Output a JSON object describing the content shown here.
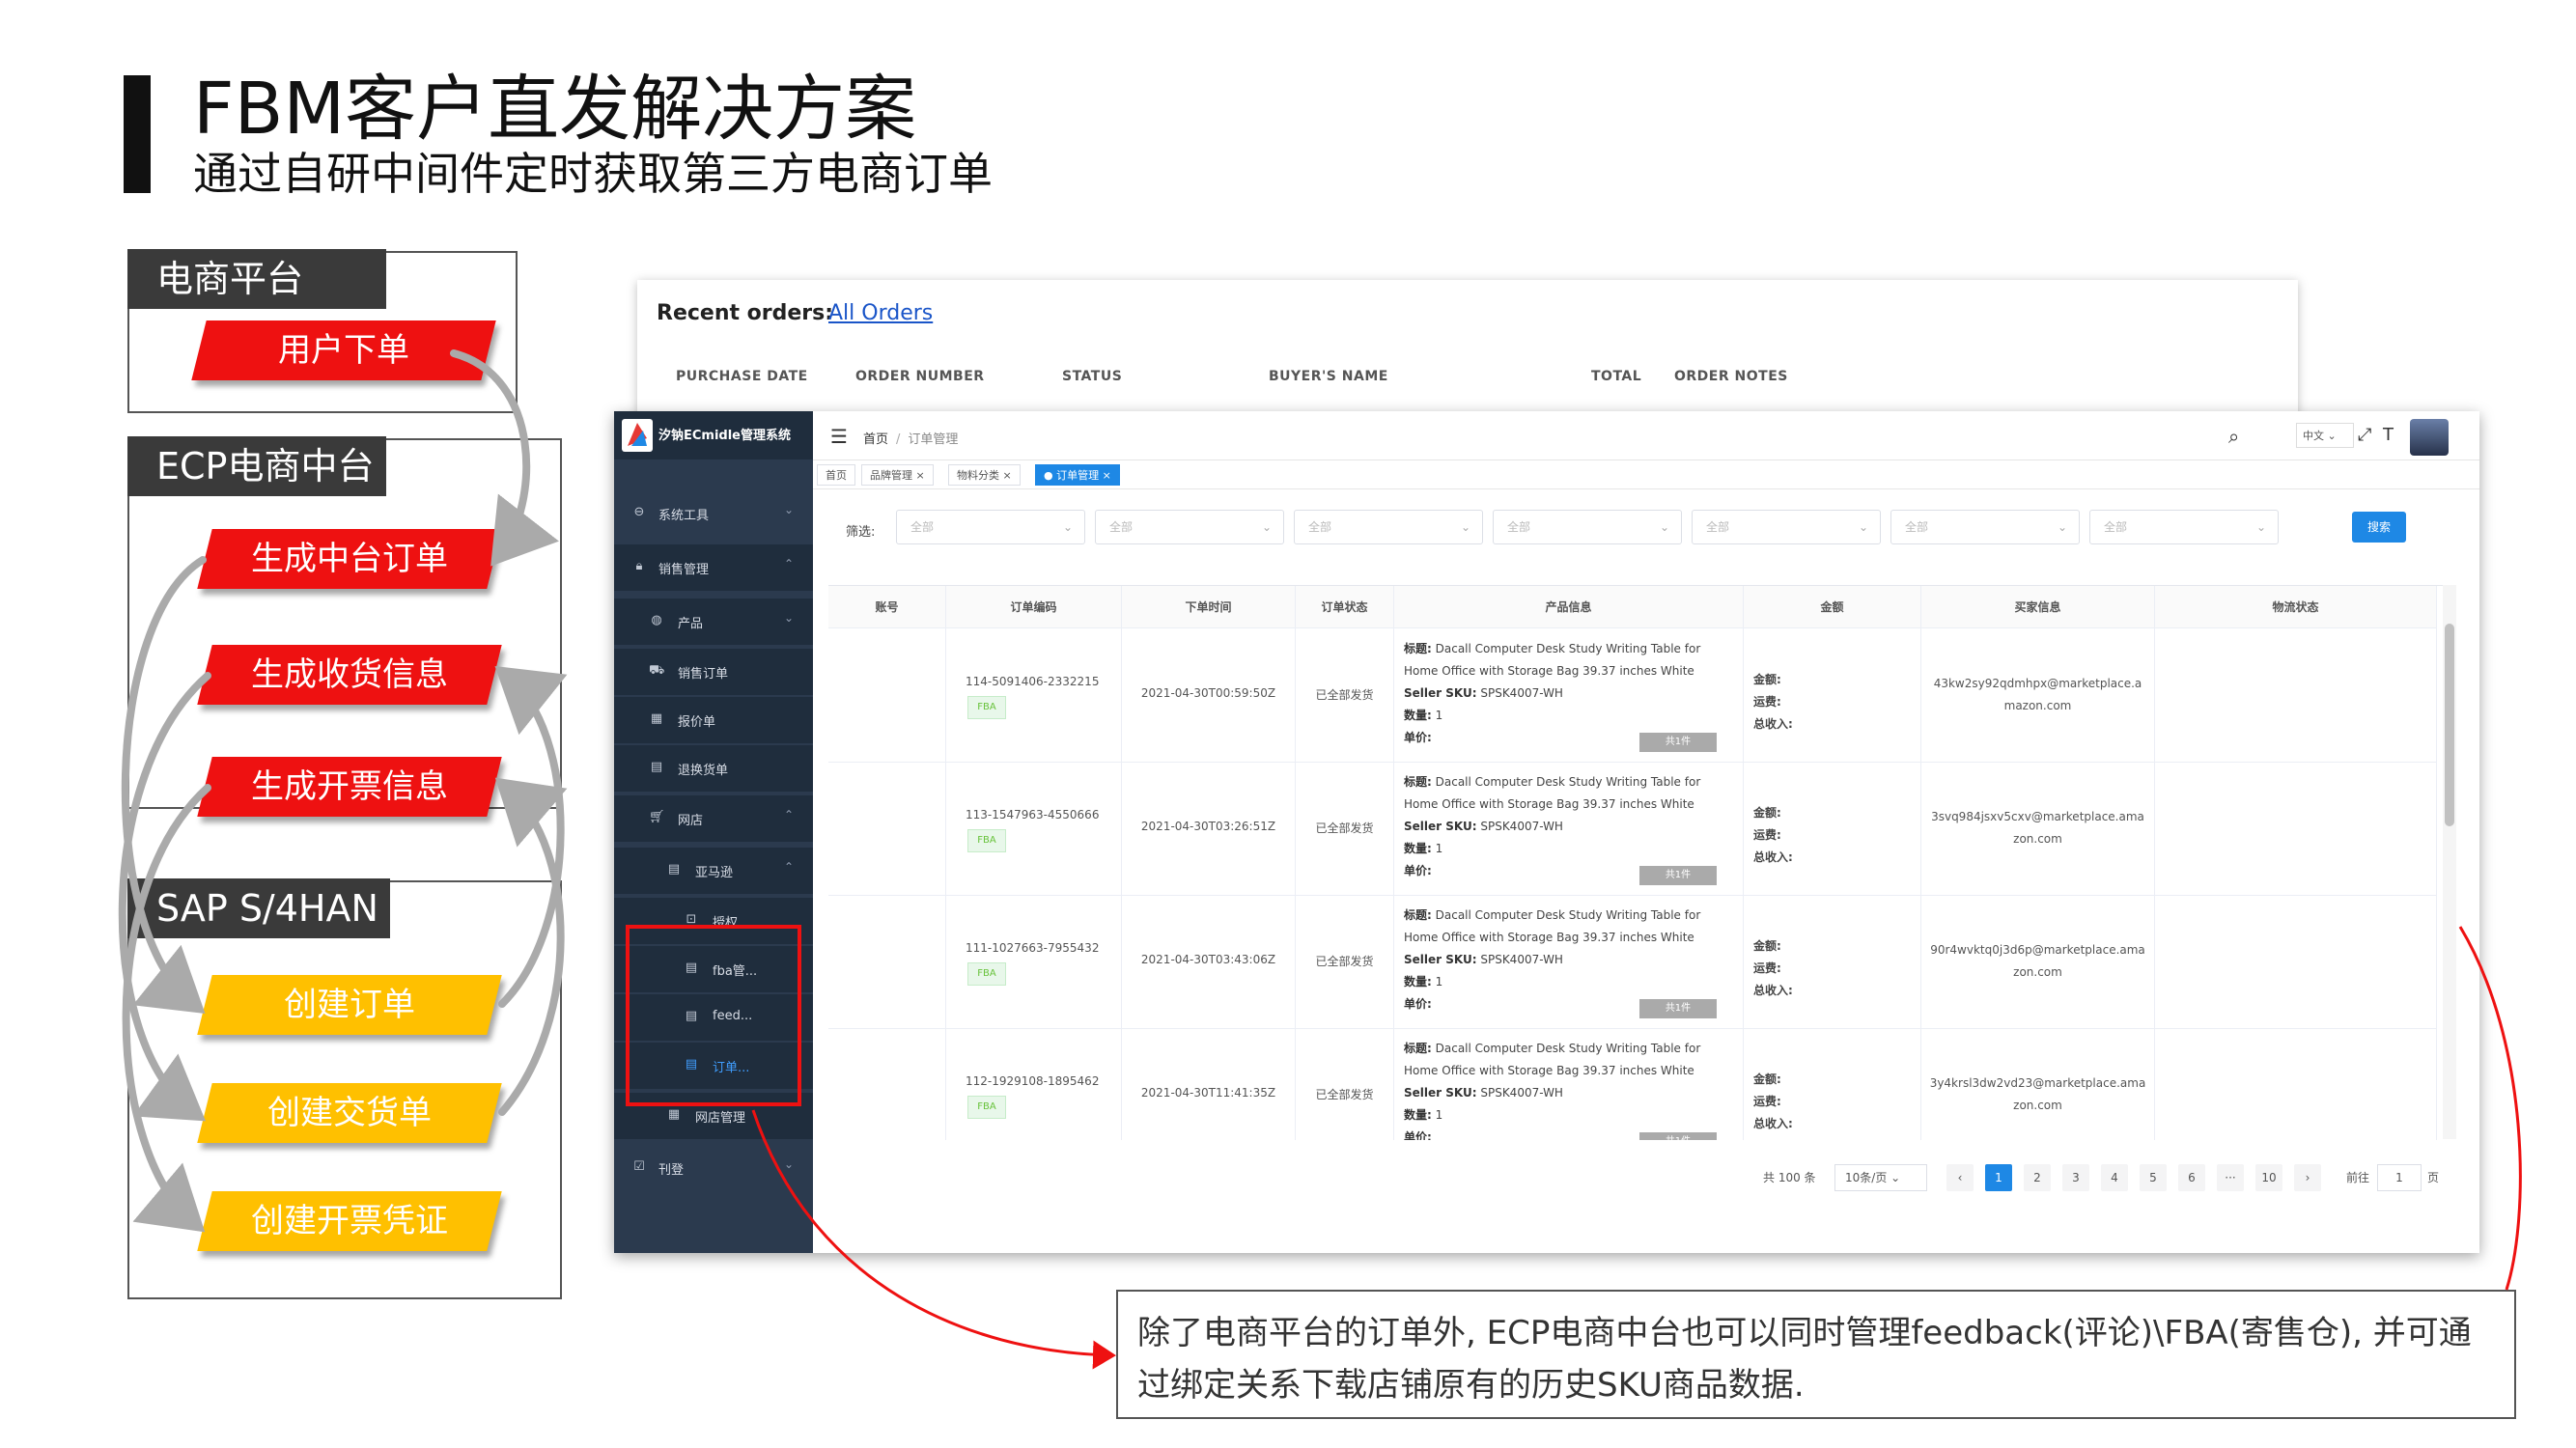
{
  "slide": {
    "title": "FBM客户直发解决方案",
    "subtitle": "通过自研中间件定时获取第三方电商订单"
  },
  "flow": {
    "panel_1": {
      "tab": "电商平台",
      "steps": [
        "用户下单"
      ]
    },
    "panel_2": {
      "tab": "ECP电商中台",
      "steps": [
        "生成中台订单",
        "生成收货信息",
        "生成开票信息"
      ]
    },
    "panel_3": {
      "tab": "SAP S/4HAN",
      "steps": [
        "创建订单",
        "创建交货单",
        "创建开票凭证"
      ]
    },
    "colors": {
      "red_step": "#ee1111",
      "yellow_step": "#ffc000",
      "tab_bg": "#3a3a3a",
      "arrow": "#aaaaaa"
    }
  },
  "bg_window": {
    "title": "Recent orders:",
    "link": "All Orders",
    "columns": [
      "PURCHASE DATE",
      "ORDER NUMBER",
      "STATUS",
      "BUYER'S NAME",
      "TOTAL",
      "ORDER NOTES"
    ]
  },
  "app": {
    "name": "汐钠ECmidle管理系统",
    "accent": "#1e88e5",
    "sidebar": {
      "items": [
        {
          "label": "系统工具",
          "icon": "tools-icon"
        },
        {
          "label": "销售管理",
          "icon": "lock-icon"
        },
        {
          "label": "产品",
          "icon": "globe-icon"
        },
        {
          "label": "销售订单",
          "icon": "cart-icon"
        },
        {
          "label": "报价单",
          "icon": "grid-icon"
        },
        {
          "label": "退换货单",
          "icon": "file-icon"
        },
        {
          "label": "网店",
          "icon": "shop-icon"
        },
        {
          "label": "亚马逊",
          "icon": "file-icon"
        },
        {
          "label": "授权...",
          "icon": "auth-icon"
        },
        {
          "label": "fba管...",
          "icon": "file-icon"
        },
        {
          "label": "feed...",
          "icon": "file-icon"
        },
        {
          "label": "订单...",
          "icon": "file-icon"
        },
        {
          "label": "网店管理",
          "icon": "grid-icon"
        },
        {
          "label": "刊登",
          "icon": "check-icon"
        }
      ]
    },
    "breadcrumb": {
      "home": "首页",
      "current": "订单管理"
    },
    "lang": "中文",
    "tags": [
      "首页",
      "品牌管理",
      "物料分类",
      "订单管理"
    ],
    "filter": {
      "label": "筛选:",
      "placeholder": "全部",
      "search_label": "搜索"
    },
    "table": {
      "headers": [
        "账号",
        "订单编码",
        "下单时间",
        "订单状态",
        "产品信息",
        "金额",
        "买家信息",
        "物流状态"
      ],
      "product_name": "Dacall Computer Desk Study Writing Table for Home Office with Storage Bag 39.37 inches White",
      "title_label": "标题:",
      "sku_label": "Seller SKU:",
      "sku": "SPSK4007-WH",
      "qty_label": "数量:",
      "qty": "1",
      "unit_label": "单价:",
      "count_btn": "共1件",
      "amount_labels": [
        "金额:",
        "运费:",
        "总收入:"
      ],
      "fba_tag": "FBA",
      "rows": [
        {
          "order_no": "114-5091406-2332215",
          "time": "2021-04-30T00:59:50Z",
          "status": "已全部发货",
          "buyer": "43kw2sy92qdmhpx@marketplace.amazon.com"
        },
        {
          "order_no": "113-1547963-4550666",
          "time": "2021-04-30T03:26:51Z",
          "status": "已全部发货",
          "buyer": "3svq984jsxv5cxv@marketplace.amazon.com"
        },
        {
          "order_no": "111-1027663-7955432",
          "time": "2021-04-30T03:43:06Z",
          "status": "已全部发货",
          "buyer": "90r4wvktq0j3d6p@marketplace.amazon.com"
        },
        {
          "order_no": "112-1929108-1895462",
          "time": "2021-04-30T11:41:35Z",
          "status": "已全部发货",
          "buyer": "3y4krsl3dw2vd23@marketplace.amazon.com"
        }
      ]
    },
    "pager": {
      "total": "共 100 条",
      "page_size": "10条/页",
      "pages": [
        "1",
        "2",
        "3",
        "4",
        "5",
        "6",
        "···",
        "10"
      ],
      "goto_label": "前往",
      "goto_value": "1",
      "goto_unit": "页"
    }
  },
  "callout": {
    "text": "除了电商平台的订单外, ECP电商中台也可以同时管理feedback(评论)\\FBA(寄售仓), 并可通过绑定关系下载店铺原有的历史SKU商品数据."
  }
}
